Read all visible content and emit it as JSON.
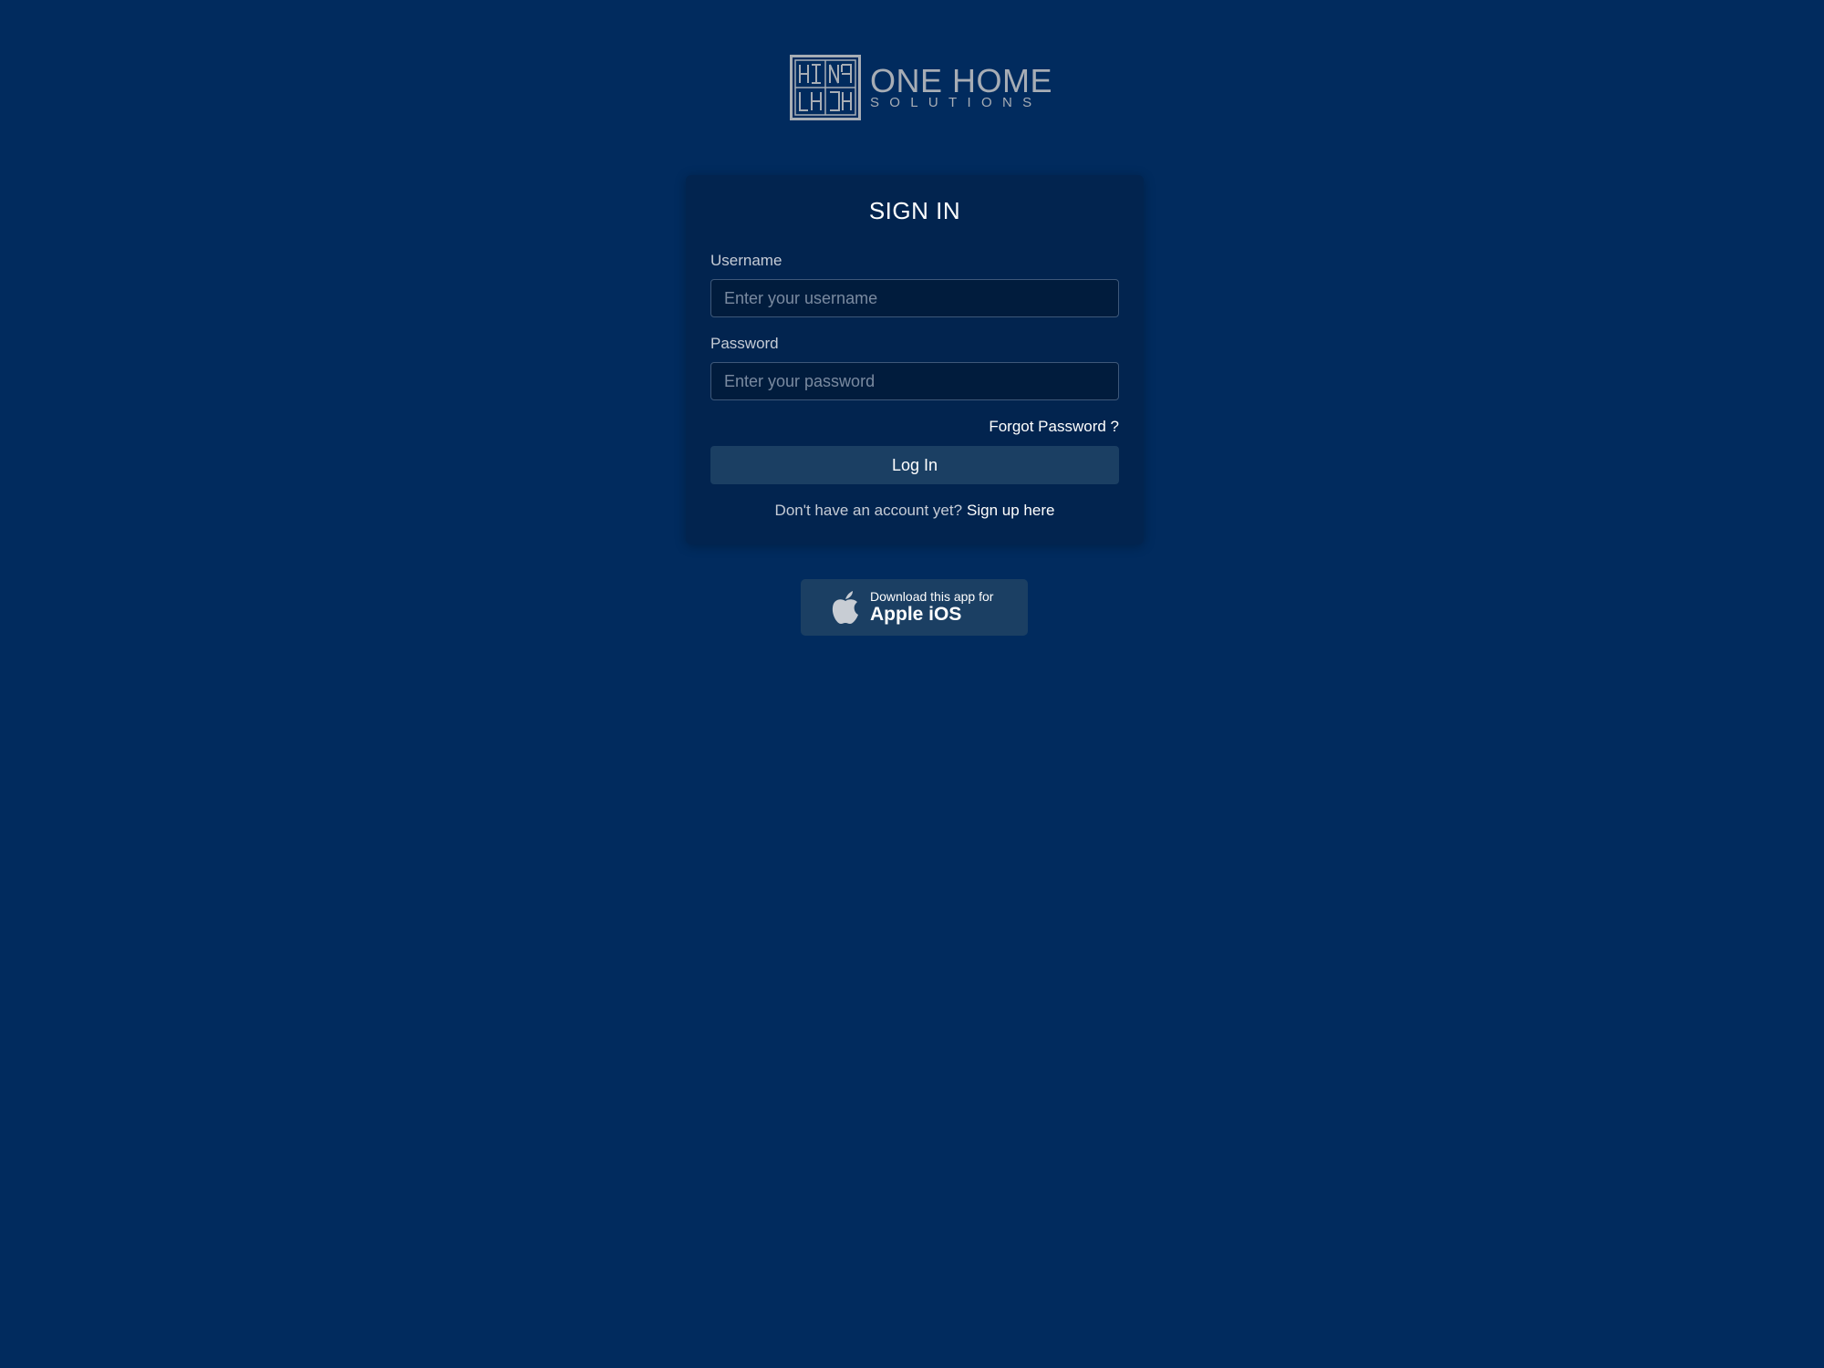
{
  "brand": {
    "name_line1": "ONE HOME",
    "name_line2": "SOLUTIONS",
    "logo_color": "#a7adb5"
  },
  "signin": {
    "title": "SIGN IN",
    "username_label": "Username",
    "username_placeholder": "Enter your username",
    "username_value": "",
    "password_label": "Password",
    "password_placeholder": "Enter your password",
    "password_value": "",
    "forgot_password": "Forgot Password ?",
    "login_button": "Log In",
    "signup_prompt": "Don't have an account yet?",
    "signup_link": "Sign up here"
  },
  "app_badge": {
    "icon": "apple-icon",
    "line1": "Download this app for",
    "line2": "Apple iOS"
  },
  "colors": {
    "background": "#012b5e",
    "card": "#02244f",
    "button": "#1b3f63",
    "text": "#ffffff"
  }
}
